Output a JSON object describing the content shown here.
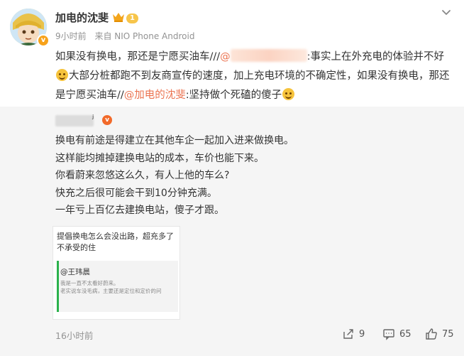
{
  "post": {
    "author": "加电的沈斐",
    "level_badge": "1",
    "time": "9小时前",
    "source": "来自 NIO Phone Android",
    "segments": {
      "s1": "如果没有换电，那还是宁愿买油车///",
      "s2": "@",
      "s3": ":事实上在外充电的体验并不好",
      "s4": "大部分桩都跑不到友商宣传的速度，加上充电环境的不确定性，如果没有换电，那还是宁愿买油车//",
      "s5": "@加电的沈斐",
      "s6": ":坚持做个死磕的傻子"
    }
  },
  "repost": {
    "name_tail": "ʲ",
    "badge": "v",
    "lines": [
      "换电有前途是得建立在其他车企一起加入进来做换电。",
      "这样能均摊掉建换电站的成本，车价也能下来。",
      "你看蔚来忽悠这么久，有人上他的车么?",
      "快充之后很可能会干到10分钟充满。",
      "一年亏上百亿去建换电站，傻子才跟。"
    ],
    "image": {
      "line1": "提倡换电怎么会没出路，超充多了",
      "line2": "不承受的住",
      "quote_name": "@王玮晨",
      "quote_line1": "我是一直不太看好蔚来。",
      "quote_line2": "老实说车没毛病，主要还是定位和定价的问"
    },
    "time": "16小时前",
    "actions": {
      "repost_count": "9",
      "comment_count": "65",
      "like_count": "75"
    }
  },
  "colors": {
    "mention": "#eb7350",
    "repost_bg": "#f5f5f5",
    "meta": "#939393"
  }
}
